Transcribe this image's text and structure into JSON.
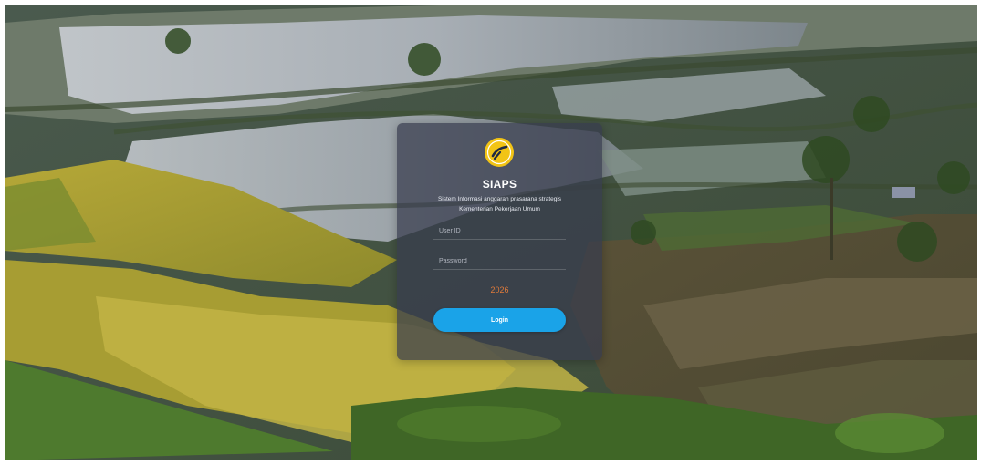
{
  "app": {
    "title": "SIAPS",
    "subtitle_line1": "Sistem Informasi anggaran prasarana strategis",
    "subtitle_line2": "Kementerian Pekerjaan Umum",
    "logo_icon": "pu-logo-icon"
  },
  "form": {
    "user_id_placeholder": "User ID",
    "password_placeholder": "Password",
    "user_id_value": "",
    "password_value": ""
  },
  "footer": {
    "year": "2026"
  },
  "actions": {
    "login_label": "Login"
  },
  "colors": {
    "accent": "#1aa3e8",
    "year": "#e07a3a",
    "card": "#373c4e",
    "logo_yellow": "#f2c416"
  }
}
